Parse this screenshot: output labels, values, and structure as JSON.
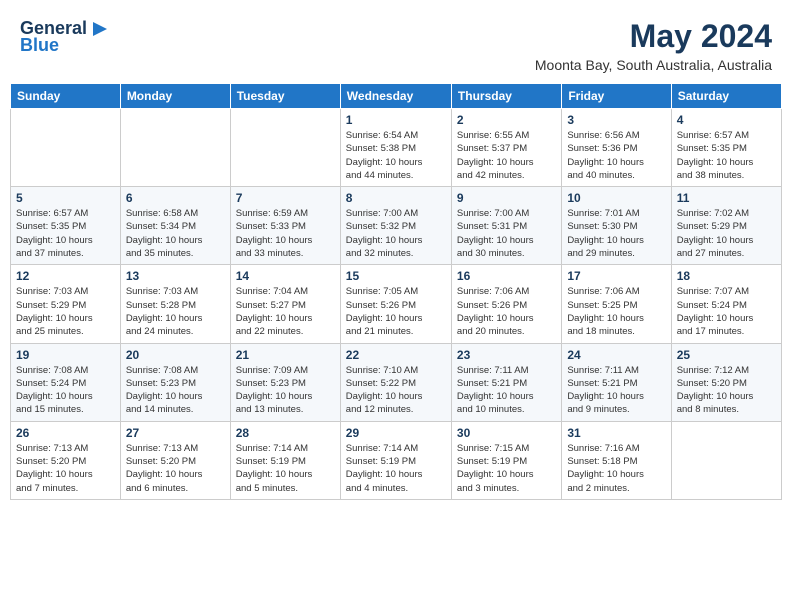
{
  "logo": {
    "line1": "General",
    "line2": "Blue"
  },
  "title": "May 2024",
  "subtitle": "Moonta Bay, South Australia, Australia",
  "days_of_week": [
    "Sunday",
    "Monday",
    "Tuesday",
    "Wednesday",
    "Thursday",
    "Friday",
    "Saturday"
  ],
  "weeks": [
    [
      {
        "day": "",
        "info": ""
      },
      {
        "day": "",
        "info": ""
      },
      {
        "day": "",
        "info": ""
      },
      {
        "day": "1",
        "info": "Sunrise: 6:54 AM\nSunset: 5:38 PM\nDaylight: 10 hours\nand 44 minutes."
      },
      {
        "day": "2",
        "info": "Sunrise: 6:55 AM\nSunset: 5:37 PM\nDaylight: 10 hours\nand 42 minutes."
      },
      {
        "day": "3",
        "info": "Sunrise: 6:56 AM\nSunset: 5:36 PM\nDaylight: 10 hours\nand 40 minutes."
      },
      {
        "day": "4",
        "info": "Sunrise: 6:57 AM\nSunset: 5:35 PM\nDaylight: 10 hours\nand 38 minutes."
      }
    ],
    [
      {
        "day": "5",
        "info": "Sunrise: 6:57 AM\nSunset: 5:35 PM\nDaylight: 10 hours\nand 37 minutes."
      },
      {
        "day": "6",
        "info": "Sunrise: 6:58 AM\nSunset: 5:34 PM\nDaylight: 10 hours\nand 35 minutes."
      },
      {
        "day": "7",
        "info": "Sunrise: 6:59 AM\nSunset: 5:33 PM\nDaylight: 10 hours\nand 33 minutes."
      },
      {
        "day": "8",
        "info": "Sunrise: 7:00 AM\nSunset: 5:32 PM\nDaylight: 10 hours\nand 32 minutes."
      },
      {
        "day": "9",
        "info": "Sunrise: 7:00 AM\nSunset: 5:31 PM\nDaylight: 10 hours\nand 30 minutes."
      },
      {
        "day": "10",
        "info": "Sunrise: 7:01 AM\nSunset: 5:30 PM\nDaylight: 10 hours\nand 29 minutes."
      },
      {
        "day": "11",
        "info": "Sunrise: 7:02 AM\nSunset: 5:29 PM\nDaylight: 10 hours\nand 27 minutes."
      }
    ],
    [
      {
        "day": "12",
        "info": "Sunrise: 7:03 AM\nSunset: 5:29 PM\nDaylight: 10 hours\nand 25 minutes."
      },
      {
        "day": "13",
        "info": "Sunrise: 7:03 AM\nSunset: 5:28 PM\nDaylight: 10 hours\nand 24 minutes."
      },
      {
        "day": "14",
        "info": "Sunrise: 7:04 AM\nSunset: 5:27 PM\nDaylight: 10 hours\nand 22 minutes."
      },
      {
        "day": "15",
        "info": "Sunrise: 7:05 AM\nSunset: 5:26 PM\nDaylight: 10 hours\nand 21 minutes."
      },
      {
        "day": "16",
        "info": "Sunrise: 7:06 AM\nSunset: 5:26 PM\nDaylight: 10 hours\nand 20 minutes."
      },
      {
        "day": "17",
        "info": "Sunrise: 7:06 AM\nSunset: 5:25 PM\nDaylight: 10 hours\nand 18 minutes."
      },
      {
        "day": "18",
        "info": "Sunrise: 7:07 AM\nSunset: 5:24 PM\nDaylight: 10 hours\nand 17 minutes."
      }
    ],
    [
      {
        "day": "19",
        "info": "Sunrise: 7:08 AM\nSunset: 5:24 PM\nDaylight: 10 hours\nand 15 minutes."
      },
      {
        "day": "20",
        "info": "Sunrise: 7:08 AM\nSunset: 5:23 PM\nDaylight: 10 hours\nand 14 minutes."
      },
      {
        "day": "21",
        "info": "Sunrise: 7:09 AM\nSunset: 5:23 PM\nDaylight: 10 hours\nand 13 minutes."
      },
      {
        "day": "22",
        "info": "Sunrise: 7:10 AM\nSunset: 5:22 PM\nDaylight: 10 hours\nand 12 minutes."
      },
      {
        "day": "23",
        "info": "Sunrise: 7:11 AM\nSunset: 5:21 PM\nDaylight: 10 hours\nand 10 minutes."
      },
      {
        "day": "24",
        "info": "Sunrise: 7:11 AM\nSunset: 5:21 PM\nDaylight: 10 hours\nand 9 minutes."
      },
      {
        "day": "25",
        "info": "Sunrise: 7:12 AM\nSunset: 5:20 PM\nDaylight: 10 hours\nand 8 minutes."
      }
    ],
    [
      {
        "day": "26",
        "info": "Sunrise: 7:13 AM\nSunset: 5:20 PM\nDaylight: 10 hours\nand 7 minutes."
      },
      {
        "day": "27",
        "info": "Sunrise: 7:13 AM\nSunset: 5:20 PM\nDaylight: 10 hours\nand 6 minutes."
      },
      {
        "day": "28",
        "info": "Sunrise: 7:14 AM\nSunset: 5:19 PM\nDaylight: 10 hours\nand 5 minutes."
      },
      {
        "day": "29",
        "info": "Sunrise: 7:14 AM\nSunset: 5:19 PM\nDaylight: 10 hours\nand 4 minutes."
      },
      {
        "day": "30",
        "info": "Sunrise: 7:15 AM\nSunset: 5:19 PM\nDaylight: 10 hours\nand 3 minutes."
      },
      {
        "day": "31",
        "info": "Sunrise: 7:16 AM\nSunset: 5:18 PM\nDaylight: 10 hours\nand 2 minutes."
      },
      {
        "day": "",
        "info": ""
      }
    ]
  ]
}
